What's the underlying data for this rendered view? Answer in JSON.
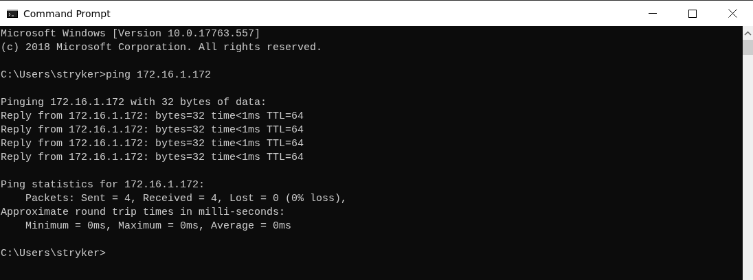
{
  "window": {
    "title": "Command Prompt"
  },
  "console": {
    "blocks": [
      [
        "Microsoft Windows [Version 10.0.17763.557]",
        "(c) 2018 Microsoft Corporation. All rights reserved."
      ],
      [
        "C:\\Users\\stryker>ping 172.16.1.172"
      ],
      [
        "Pinging 172.16.1.172 with 32 bytes of data:",
        "Reply from 172.16.1.172: bytes=32 time<1ms TTL=64",
        "Reply from 172.16.1.172: bytes=32 time<1ms TTL=64",
        "Reply from 172.16.1.172: bytes=32 time<1ms TTL=64",
        "Reply from 172.16.1.172: bytes=32 time<1ms TTL=64"
      ],
      [
        "Ping statistics for 172.16.1.172:",
        "    Packets: Sent = 4, Received = 4, Lost = 0 (0% loss),",
        "Approximate round trip times in milli-seconds:",
        "    Minimum = 0ms, Maximum = 0ms, Average = 0ms"
      ],
      [
        "C:\\Users\\stryker>"
      ]
    ]
  }
}
